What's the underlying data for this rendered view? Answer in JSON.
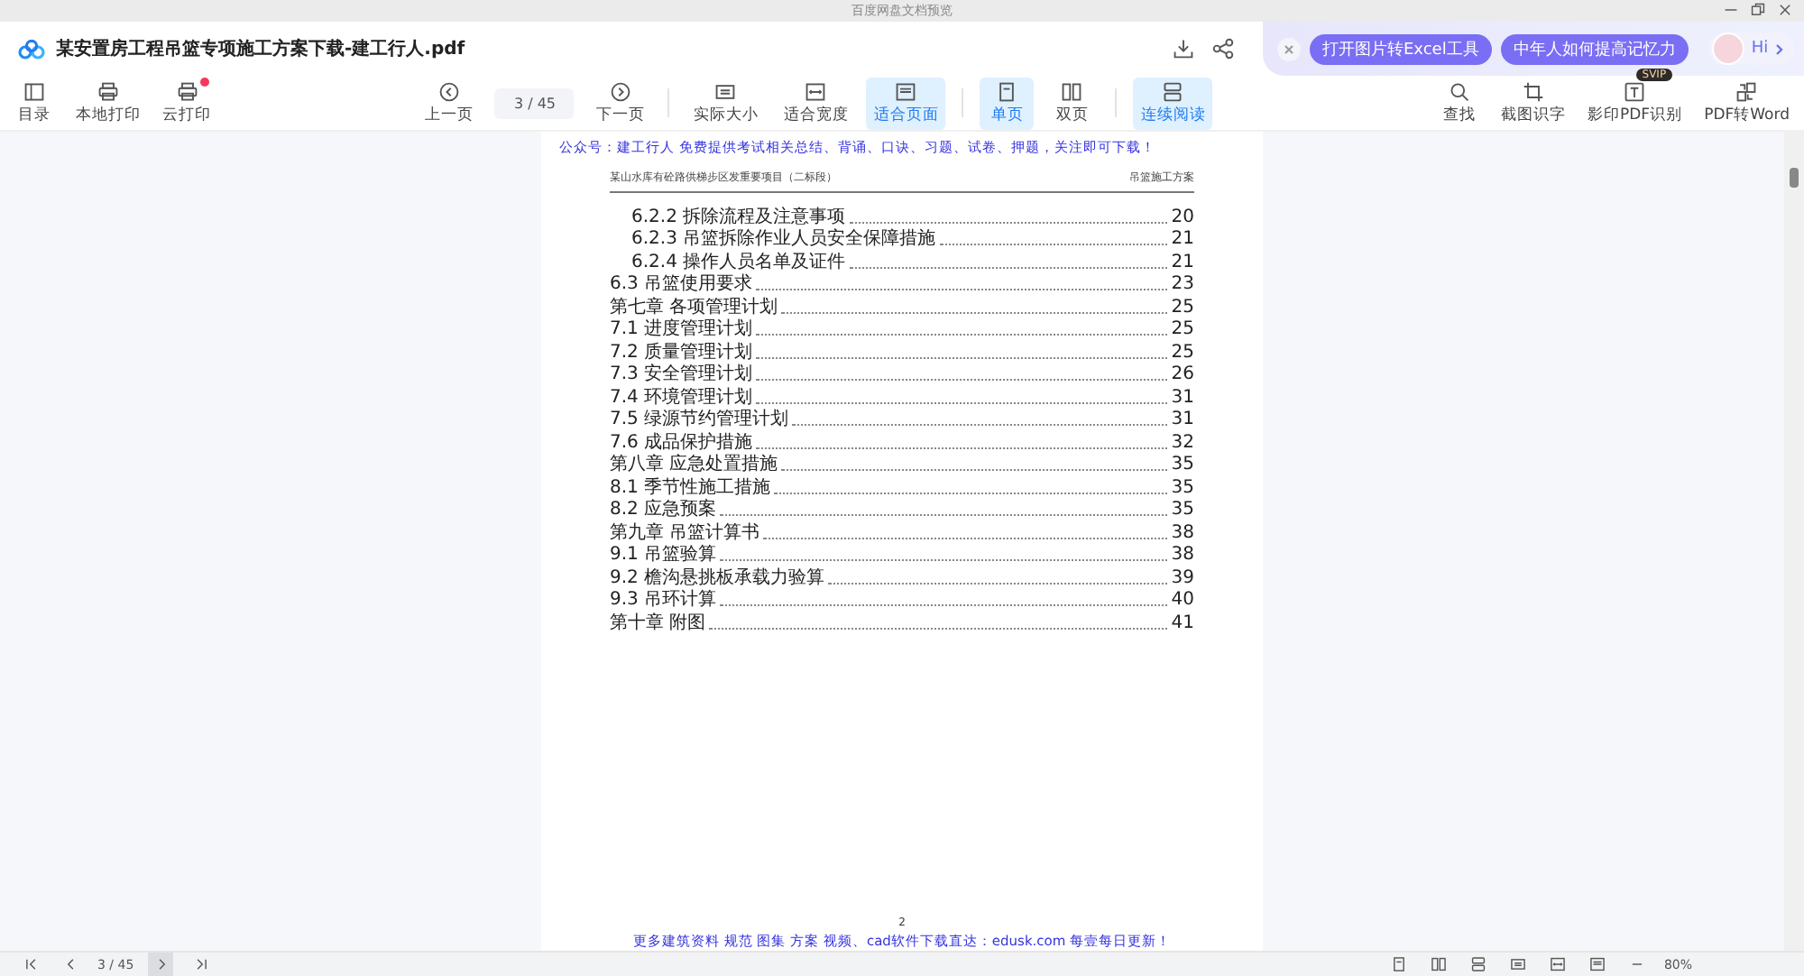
{
  "window": {
    "title": "百度网盘文档预览"
  },
  "document": {
    "filename": "某安置房工程吊篮专项施工方案下载-建工行人.pdf"
  },
  "promo": {
    "pills": [
      "打开图片转Excel工具",
      "中年人如何提高记忆力"
    ],
    "assistant": "Hi"
  },
  "toolbar": {
    "left": [
      {
        "label": "目录",
        "notification": false
      },
      {
        "label": "本地打印",
        "notification": false
      },
      {
        "label": "云打印",
        "notification": true
      }
    ],
    "prev": "上一页",
    "page_input": {
      "value": "3",
      "total": "/ 45"
    },
    "next": "下一页",
    "groups": [
      {
        "items": [
          {
            "label": "实际大小",
            "selected": false
          },
          {
            "label": "适合宽度",
            "selected": false
          },
          {
            "label": "适合页面",
            "selected": true
          }
        ]
      },
      {
        "items": [
          {
            "label": "单页",
            "selected": true
          },
          {
            "label": "双页",
            "selected": false
          }
        ]
      },
      {
        "items": [
          {
            "label": "连续阅读",
            "selected": true
          }
        ]
      }
    ],
    "right": [
      {
        "label": "查找"
      },
      {
        "label": "截图识字"
      },
      {
        "label": "影印PDF识别",
        "badge": "SVIP"
      },
      {
        "label": "PDF转Word"
      }
    ]
  },
  "page": {
    "notice": "公众号：建工行人 免费提供考试相关总结、背诵、口诀、习题、试卷、押题，关注即可下载！",
    "header_left": "某山水库有砼路供梯步区发重要项目（二标段）",
    "header_right": "吊篮施工方案",
    "toc": [
      {
        "children": [
          {
            "children": [
              {
                "title": "6.2.2 拆除流程及注意事项",
                "page": "20"
              },
              {
                "title": "6.2.3 吊篮拆除作业人员安全保障措施",
                "page": "21"
              },
              {
                "title": "6.2.4 操作人员名单及证件",
                "page": "21"
              }
            ]
          },
          {
            "title": "6.3 吊篮使用要求",
            "page": "23"
          }
        ]
      },
      {
        "title": "第七章 各项管理计划",
        "page": "25",
        "children": [
          {
            "title": "7.1  进度管理计划",
            "page": "25"
          },
          {
            "title": "7.2  质量管理计划",
            "page": "25"
          },
          {
            "title": "7.3  安全管理计划",
            "page": "26"
          },
          {
            "title": "7.4 环境管理计划",
            "page": "31"
          },
          {
            "title": "7.5 绿源节约管理计划",
            "page": "31"
          },
          {
            "title": "7.6 成品保护措施",
            "page": "32"
          }
        ]
      },
      {
        "title": "第八章 应急处置措施",
        "page": "35",
        "children": [
          {
            "title": "8.1 季节性施工措施",
            "page": "35"
          },
          {
            "title": "8.2 应急预案",
            "page": "35"
          }
        ]
      },
      {
        "title": "第九章 吊篮计算书",
        "page": "38",
        "children": [
          {
            "title": "9.1 吊篮验算",
            "page": "38"
          },
          {
            "title": "9.2 檐沟悬挑板承载力验算",
            "page": "39"
          },
          {
            "title": "9.3 吊环计算",
            "page": "40"
          }
        ]
      },
      {
        "title": "第十章 附图",
        "page": "41"
      }
    ],
    "page_number": "2",
    "footer": "更多建筑资料 规范 图集 方案 视频、cad软件下载直达：edusk.com 每壹每日更新！"
  },
  "status_bar": {
    "page_value": "3",
    "page_total": "/ 45",
    "zoom": "80%"
  }
}
